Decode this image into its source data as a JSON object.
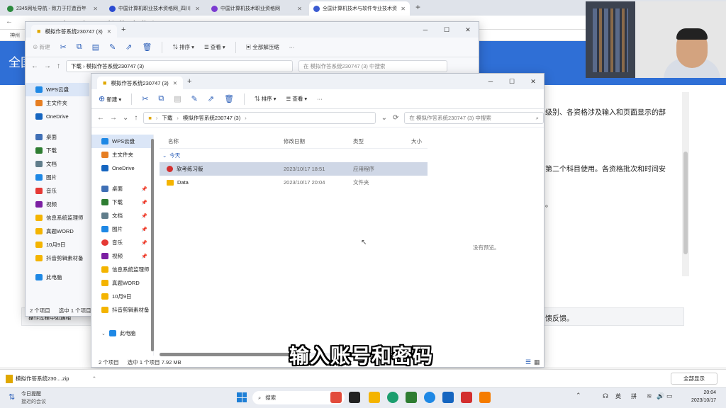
{
  "browser": {
    "tabs": [
      {
        "title": "2345网址导航 - 致力于打造百年",
        "color": "#2b8a3e"
      },
      {
        "title": "中国计算机职业技术资格网_四川",
        "color": "#2b4bd1"
      },
      {
        "title": "中国计算机技术职业资格网",
        "color": "#7b3bd1"
      },
      {
        "title": "全国计算机技术与软件专业技术资",
        "color": "#3b5bd1"
      }
    ],
    "new_tab_icon": "+",
    "url": "bm.ruankao.org.cn/sign/download/main",
    "bookmark": "神州",
    "page_title": "全国",
    "page_lines": [
      "级别、各资格涉及输入和页面显示的部",
      "第二个科目使用。各资格批次和时间安",
      "。",
      "馈反馈。"
    ],
    "page_hint": "操作过程中如遇相"
  },
  "back_window": {
    "tab_title": "模拟作答系统230747 (3)",
    "toolbar": [
      "新建",
      "排序",
      "查看",
      "全部解压缩",
      "···"
    ],
    "path": "下载 › 模拟作答系统230747 (3)",
    "search_placeholder": "在 模拟作答系统230747 (3) 中搜索",
    "sidebar": [
      "WPS云盘",
      "主文件夹",
      "OneDrive",
      "桌面",
      "下载",
      "文档",
      "图片",
      "音乐",
      "视频",
      "信息系统监理师",
      "真题WORD",
      "10月9日",
      "抖音剪辑素材备",
      "此电脑"
    ],
    "status": [
      "2 个项目",
      "选中 1 个项目"
    ]
  },
  "front_window": {
    "tab_title": "模拟作答系统230747 (3)",
    "toolbar": {
      "new": "新建",
      "sort": "排序",
      "view": "查看",
      "more": "···"
    },
    "path": [
      "下载",
      "模拟作答系统230747 (3)"
    ],
    "search_placeholder": "在 模拟作答系统230747 (3) 中搜索",
    "sidebar": [
      {
        "label": "WPS云盘",
        "color": "#1e88e5",
        "pin": false
      },
      {
        "label": "主文件夹",
        "color": "#e67e22",
        "pin": false
      },
      {
        "label": "OneDrive",
        "color": "#1565c0",
        "pin": false
      },
      {
        "label": "桌面",
        "color": "#3f6fb5",
        "pin": true
      },
      {
        "label": "下载",
        "color": "#2e7d32",
        "pin": true
      },
      {
        "label": "文档",
        "color": "#607d8b",
        "pin": true
      },
      {
        "label": "图片",
        "color": "#1e88e5",
        "pin": true
      },
      {
        "label": "音乐",
        "color": "#e53935",
        "pin": true
      },
      {
        "label": "视频",
        "color": "#7b1fa2",
        "pin": true
      },
      {
        "label": "信息系统监理师",
        "color": "#f4b400",
        "pin": false
      },
      {
        "label": "真题WORD",
        "color": "#f4b400",
        "pin": false
      },
      {
        "label": "10月9日",
        "color": "#f4b400",
        "pin": false
      },
      {
        "label": "抖音剪辑素材备",
        "color": "#f4b400",
        "pin": false
      },
      {
        "label": "此电脑",
        "color": "#1e88e5",
        "pin": false
      }
    ],
    "columns": [
      "名称",
      "修改日期",
      "类型",
      "大小"
    ],
    "group": "今天",
    "files": [
      {
        "name": "软考练习版",
        "date": "2023/10/17 18:51",
        "type": "应用程序",
        "icon": "app-icon",
        "color": "#d32f2f"
      },
      {
        "name": "Data",
        "date": "2023/10/17 20:04",
        "type": "文件夹",
        "icon": "folder-icon",
        "color": "#f4b400"
      }
    ],
    "preview": "没有预览。",
    "status": [
      "2 个项目",
      "选中 1 个项目 7.92 MB"
    ]
  },
  "subtitle": "输入账号和密码",
  "download_bar": {
    "file": "模拟作答系统230....zip",
    "show_all": "全部显示"
  },
  "taskbar": {
    "weather_line1": "今日提醒",
    "weather_line2": "接近的会议",
    "search": "搜索",
    "ime": [
      "英",
      "拼"
    ],
    "time": "20:04",
    "date": "2023/10/17"
  }
}
